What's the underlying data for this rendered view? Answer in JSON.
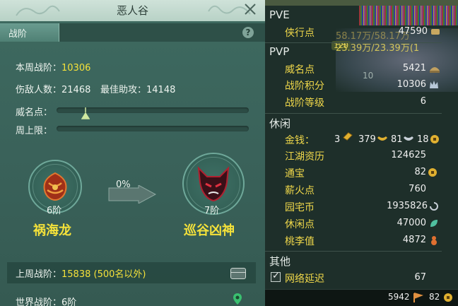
{
  "window": {
    "title": "恶人谷"
  },
  "tabs": {
    "active": "战阶",
    "help": "?"
  },
  "week": {
    "label": "本周战阶：",
    "value": "10306",
    "kills_label": "伤敌人数：",
    "kills_value": "21468",
    "assist_label": "最佳助攻：",
    "assist_value": "14148"
  },
  "bars": {
    "prestige_label": "威名点：",
    "weekly_cap_label": "周上限："
  },
  "ranks": {
    "progress": "0%",
    "current_tier": "6阶",
    "current_name": "祸海龙",
    "next_tier": "7阶",
    "next_name": "巡谷凶神"
  },
  "last_week": {
    "label": "上周战阶：",
    "value": "15838 (500名以外)"
  },
  "world": {
    "label": "世界战阶：",
    "value": "6阶"
  },
  "currency": {
    "pve_header": "PVE",
    "pve": [
      {
        "label": "侠行点",
        "value": "47590",
        "icon": "scroll-icon"
      }
    ],
    "pvp_header": "PVP",
    "pvp": [
      {
        "label": "威名点",
        "value": "5421",
        "icon": "helmet-icon"
      },
      {
        "label": "战阶积分",
        "value": "10306",
        "icon": "crown-icon"
      },
      {
        "label": "战阶等级",
        "value": "6",
        "icon": ""
      }
    ],
    "leisure_header": "休闲",
    "money": {
      "label": "金钱：",
      "gold_brick": "3",
      "gold": "379",
      "silver": "81",
      "copper": "18"
    },
    "leisure": [
      {
        "label": "江湖资历",
        "value": "124625",
        "icon": ""
      },
      {
        "label": "通宝",
        "value": "82",
        "icon": "coin-icon"
      },
      {
        "label": "薪火点",
        "value": "760",
        "icon": ""
      },
      {
        "label": "园宅币",
        "value": "1935826",
        "icon": "swirl-icon"
      },
      {
        "label": "休闲点",
        "value": "47000",
        "icon": "leaf-icon"
      },
      {
        "label": "桃李值",
        "value": "4872",
        "icon": "gourd-icon"
      }
    ],
    "other_header": "其他",
    "latency": {
      "label": "网络延迟",
      "value": "67"
    }
  },
  "bottom": {
    "left_value": "5942",
    "right_value": "82"
  },
  "overlay": {
    "text1": "58.17万/58.17万",
    "text2": "23.39万/23.39万(1",
    "level": "120",
    "num": "10"
  },
  "colors": {
    "accent_yellow": "#f5e23a",
    "panel_green": "#3e6a60",
    "label_gold": "#f0d84a"
  }
}
